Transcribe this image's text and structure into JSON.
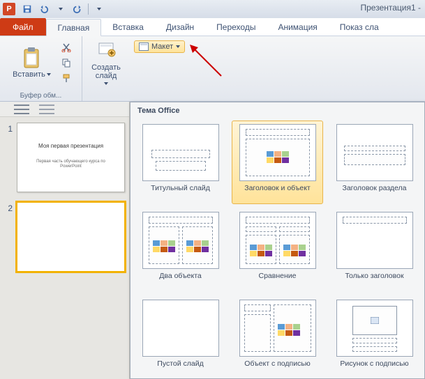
{
  "title": "Презентация1 -",
  "tabs": {
    "file": "Файл",
    "items": [
      "Главная",
      "Вставка",
      "Дизайн",
      "Переходы",
      "Анимация",
      "Показ сла"
    ]
  },
  "ribbon": {
    "clipboard": {
      "paste": "Вставить",
      "group_label": "Буфер обм..."
    },
    "slides": {
      "new_slide": "Создать слайд",
      "layout": "Макет"
    }
  },
  "slide_panel": {
    "slides": [
      {
        "num": "1",
        "title": "Моя первая презентация",
        "sub": "Первая часть обучающего курса по PowerPoint"
      },
      {
        "num": "2",
        "title": "",
        "sub": ""
      }
    ]
  },
  "gallery": {
    "header": "Тема Office",
    "layouts": [
      "Титульный слайд",
      "Заголовок и объект",
      "Заголовок раздела",
      "Два объекта",
      "Сравнение",
      "Только заголовок",
      "Пустой слайд",
      "Объект с подписью",
      "Рисунок с подписью"
    ]
  }
}
